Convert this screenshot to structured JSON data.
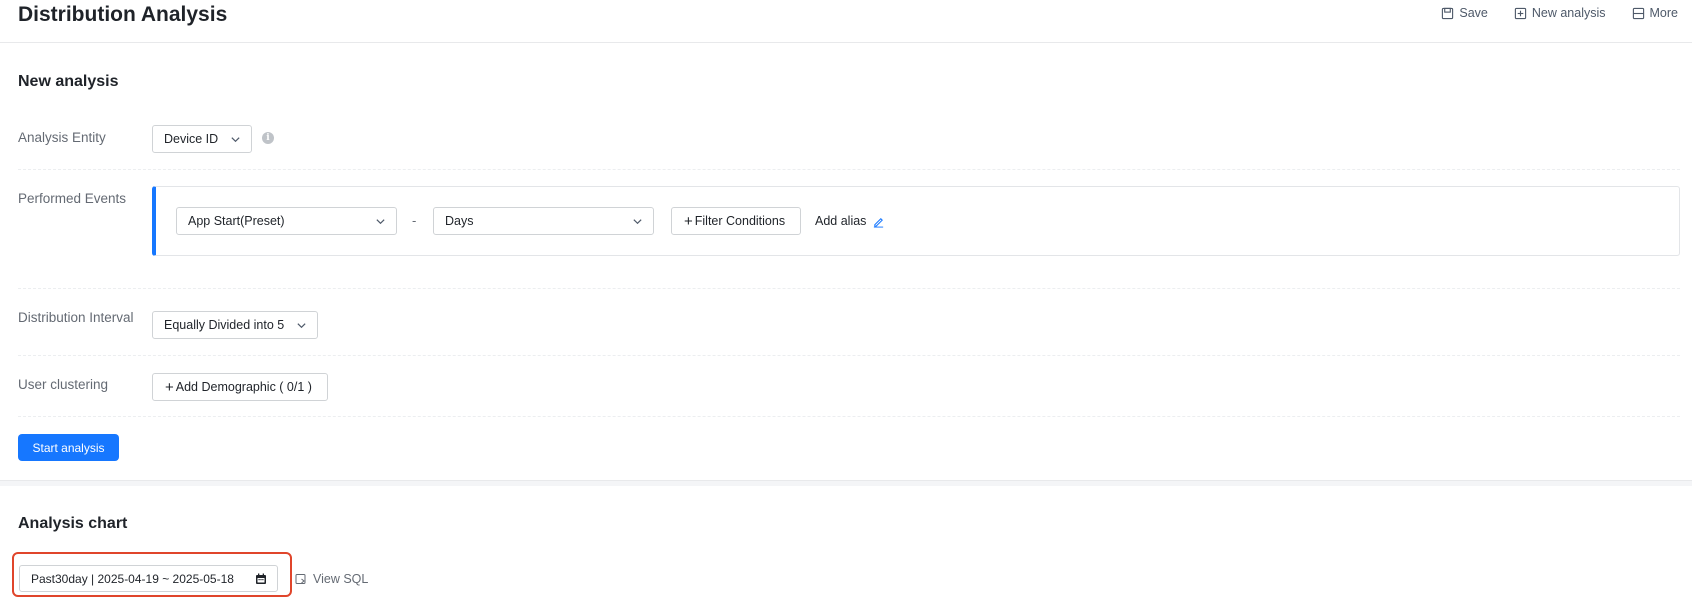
{
  "header": {
    "title": "Distribution Analysis",
    "actions": [
      {
        "label": "Save",
        "icon": "save-icon"
      },
      {
        "label": "New analysis",
        "icon": "new-analysis-icon"
      },
      {
        "label": "More",
        "icon": "more-icon"
      }
    ]
  },
  "form": {
    "section_title": "New analysis",
    "analysis_entity": {
      "label": "Analysis Entity",
      "value": "Device ID"
    },
    "performed_events": {
      "label": "Performed Events",
      "event": "App Start(Preset)",
      "separator": "-",
      "metric": "Days",
      "filter_button": "Filter Conditions",
      "add_alias": "Add alias"
    },
    "distribution_interval": {
      "label": "Distribution Interval",
      "value": "Equally Divided into 5"
    },
    "user_clustering": {
      "label": "User clustering",
      "button": "Add Demographic ( 0/1 )"
    },
    "start_button": "Start analysis"
  },
  "chart": {
    "section_title": "Analysis chart",
    "date_range": "Past30day | 2025-04-19 ~ 2025-05-18",
    "view_sql": "View SQL"
  },
  "colors": {
    "primary": "#1677ff",
    "highlight": "#e0452b"
  }
}
